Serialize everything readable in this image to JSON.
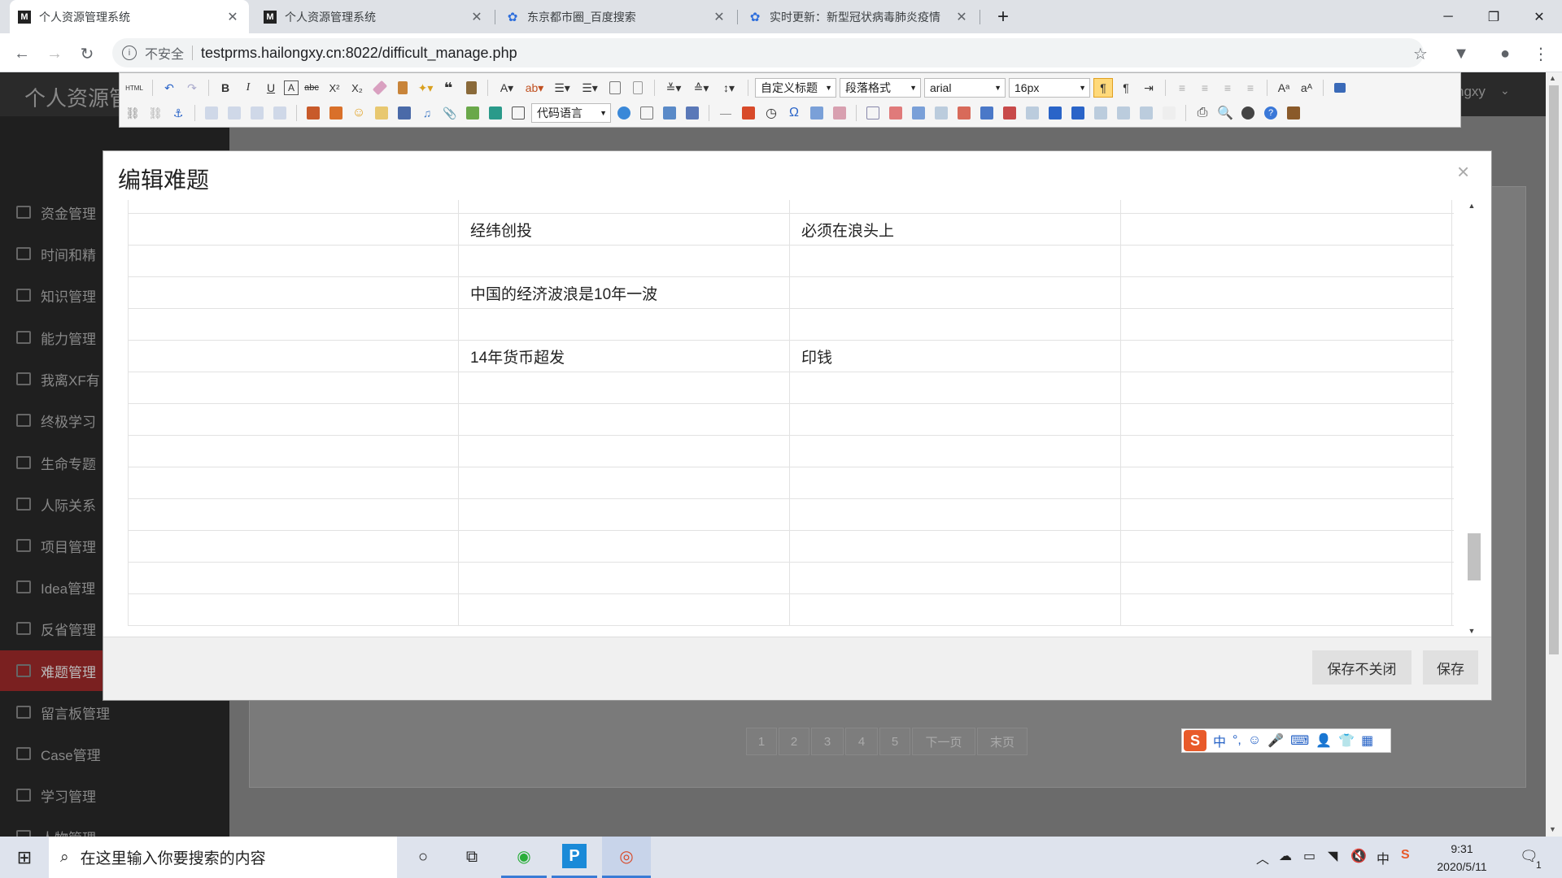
{
  "browser": {
    "tabs": [
      {
        "title": "个人资源管理系统",
        "favicon": "M",
        "active": true
      },
      {
        "title": "个人资源管理系统",
        "favicon": "M",
        "active": false
      },
      {
        "title": "东京都市圈_百度搜索",
        "favicon": "baidu-paw",
        "active": false
      },
      {
        "title": "实时更新：新型冠状病毒肺炎疫情",
        "favicon": "baidu-paw",
        "active": false
      }
    ],
    "new_tab": "+",
    "security_label": "不安全",
    "url": "testprms.hailongxy.cn:8022/difficult_manage.php"
  },
  "app": {
    "brand": "个人资源管",
    "user": "ngxy",
    "sidebar": [
      {
        "label": "资金管理"
      },
      {
        "label": "时间和精"
      },
      {
        "label": "知识管理"
      },
      {
        "label": "能力管理"
      },
      {
        "label": "我离XF有"
      },
      {
        "label": "终极学习"
      },
      {
        "label": "生命专题"
      },
      {
        "label": "人际关系"
      },
      {
        "label": "项目管理"
      },
      {
        "label": "Idea管理"
      },
      {
        "label": "反省管理"
      },
      {
        "label": "难题管理",
        "active": true
      },
      {
        "label": "留言板管理"
      },
      {
        "label": "Case管理"
      },
      {
        "label": "学习管理"
      },
      {
        "label": "人物管理"
      }
    ],
    "pagination": [
      "1",
      "2",
      "3",
      "4",
      "5",
      "下一页",
      "末页"
    ]
  },
  "editor_toolbar": {
    "html_label": "HTML",
    "title_select": "自定义标题",
    "paragraph_select": "段落格式",
    "font_select": "arial",
    "size_select": "16px",
    "code_select": "代码语言"
  },
  "modal": {
    "title": "编辑难题",
    "table_rows": [
      [
        "",
        "",
        "",
        ""
      ],
      [
        "",
        "经纬创投",
        "必须在浪头上",
        ""
      ],
      [
        "",
        "",
        "",
        ""
      ],
      [
        "",
        "中国的经济波浪是10年一波",
        "",
        ""
      ],
      [
        "",
        "",
        "",
        ""
      ],
      [
        "",
        "14年货币超发",
        "印钱",
        ""
      ],
      [
        "",
        "",
        "",
        ""
      ],
      [
        "",
        "",
        "",
        ""
      ],
      [
        "",
        "",
        "",
        ""
      ],
      [
        "",
        "",
        "",
        ""
      ],
      [
        "",
        "",
        "",
        ""
      ],
      [
        "",
        "",
        "",
        ""
      ],
      [
        "",
        "",
        "",
        ""
      ],
      [
        "",
        "",
        "",
        ""
      ]
    ],
    "save_no_close": "保存不关闭",
    "save": "保存"
  },
  "ime": {
    "mode": "中",
    "punct": "°,"
  },
  "taskbar": {
    "search_placeholder": "在这里输入你要搜索的内容",
    "time": "9:31",
    "date": "2020/5/11",
    "notifications": "1"
  }
}
